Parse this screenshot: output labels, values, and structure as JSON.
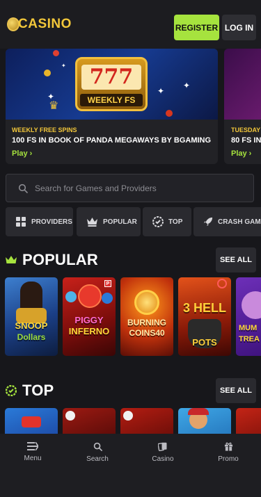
{
  "header": {
    "logo_text": "CASINO",
    "register_label": "REGISTER",
    "login_label": "LOG IN"
  },
  "promos": [
    {
      "art_label": "777",
      "art_sublabel": "WEEKLY FS",
      "subtitle": "WEEKLY FREE SPINS",
      "title": "100 FS IN BOOK OF PANDA MEGAWAYS BY BGAMING",
      "cta": "Play ›"
    },
    {
      "subtitle": "TUESDAY R",
      "title": "80 FS IN",
      "cta": "Play ›"
    }
  ],
  "search": {
    "placeholder": "Search for Games and Providers"
  },
  "categories": [
    {
      "label": "PROVIDERS",
      "icon": "grid-icon"
    },
    {
      "label": "POPULAR",
      "icon": "crown-icon"
    },
    {
      "label": "TOP",
      "icon": "badge-icon"
    },
    {
      "label": "CRASH GAMES",
      "icon": "rocket-icon"
    }
  ],
  "popular_section": {
    "title": "POPULAR",
    "see_all": "SEE ALL",
    "games": [
      {
        "name_line1": "SNOOP",
        "name_line2": "Dollars"
      },
      {
        "name_line1": "PIGGY",
        "name_line2": "INFERNO"
      },
      {
        "name_line1": "BURNING",
        "name_line2": "COINS40"
      },
      {
        "name_line1": "3 HELL",
        "name_line2": "POTS"
      },
      {
        "name_line1": "MUM",
        "name_line2": "TREA"
      }
    ]
  },
  "top_section": {
    "title": "TOP",
    "see_all": "SEE ALL"
  },
  "bottom_nav": [
    {
      "label": "Menu",
      "icon": "menu-icon"
    },
    {
      "label": "Search",
      "icon": "search-icon"
    },
    {
      "label": "Casino",
      "icon": "cards-icon"
    },
    {
      "label": "Promo",
      "icon": "gift-icon"
    }
  ],
  "colors": {
    "accent_green": "#a6e33e",
    "gold": "#f2c73a",
    "background": "#17171b"
  }
}
